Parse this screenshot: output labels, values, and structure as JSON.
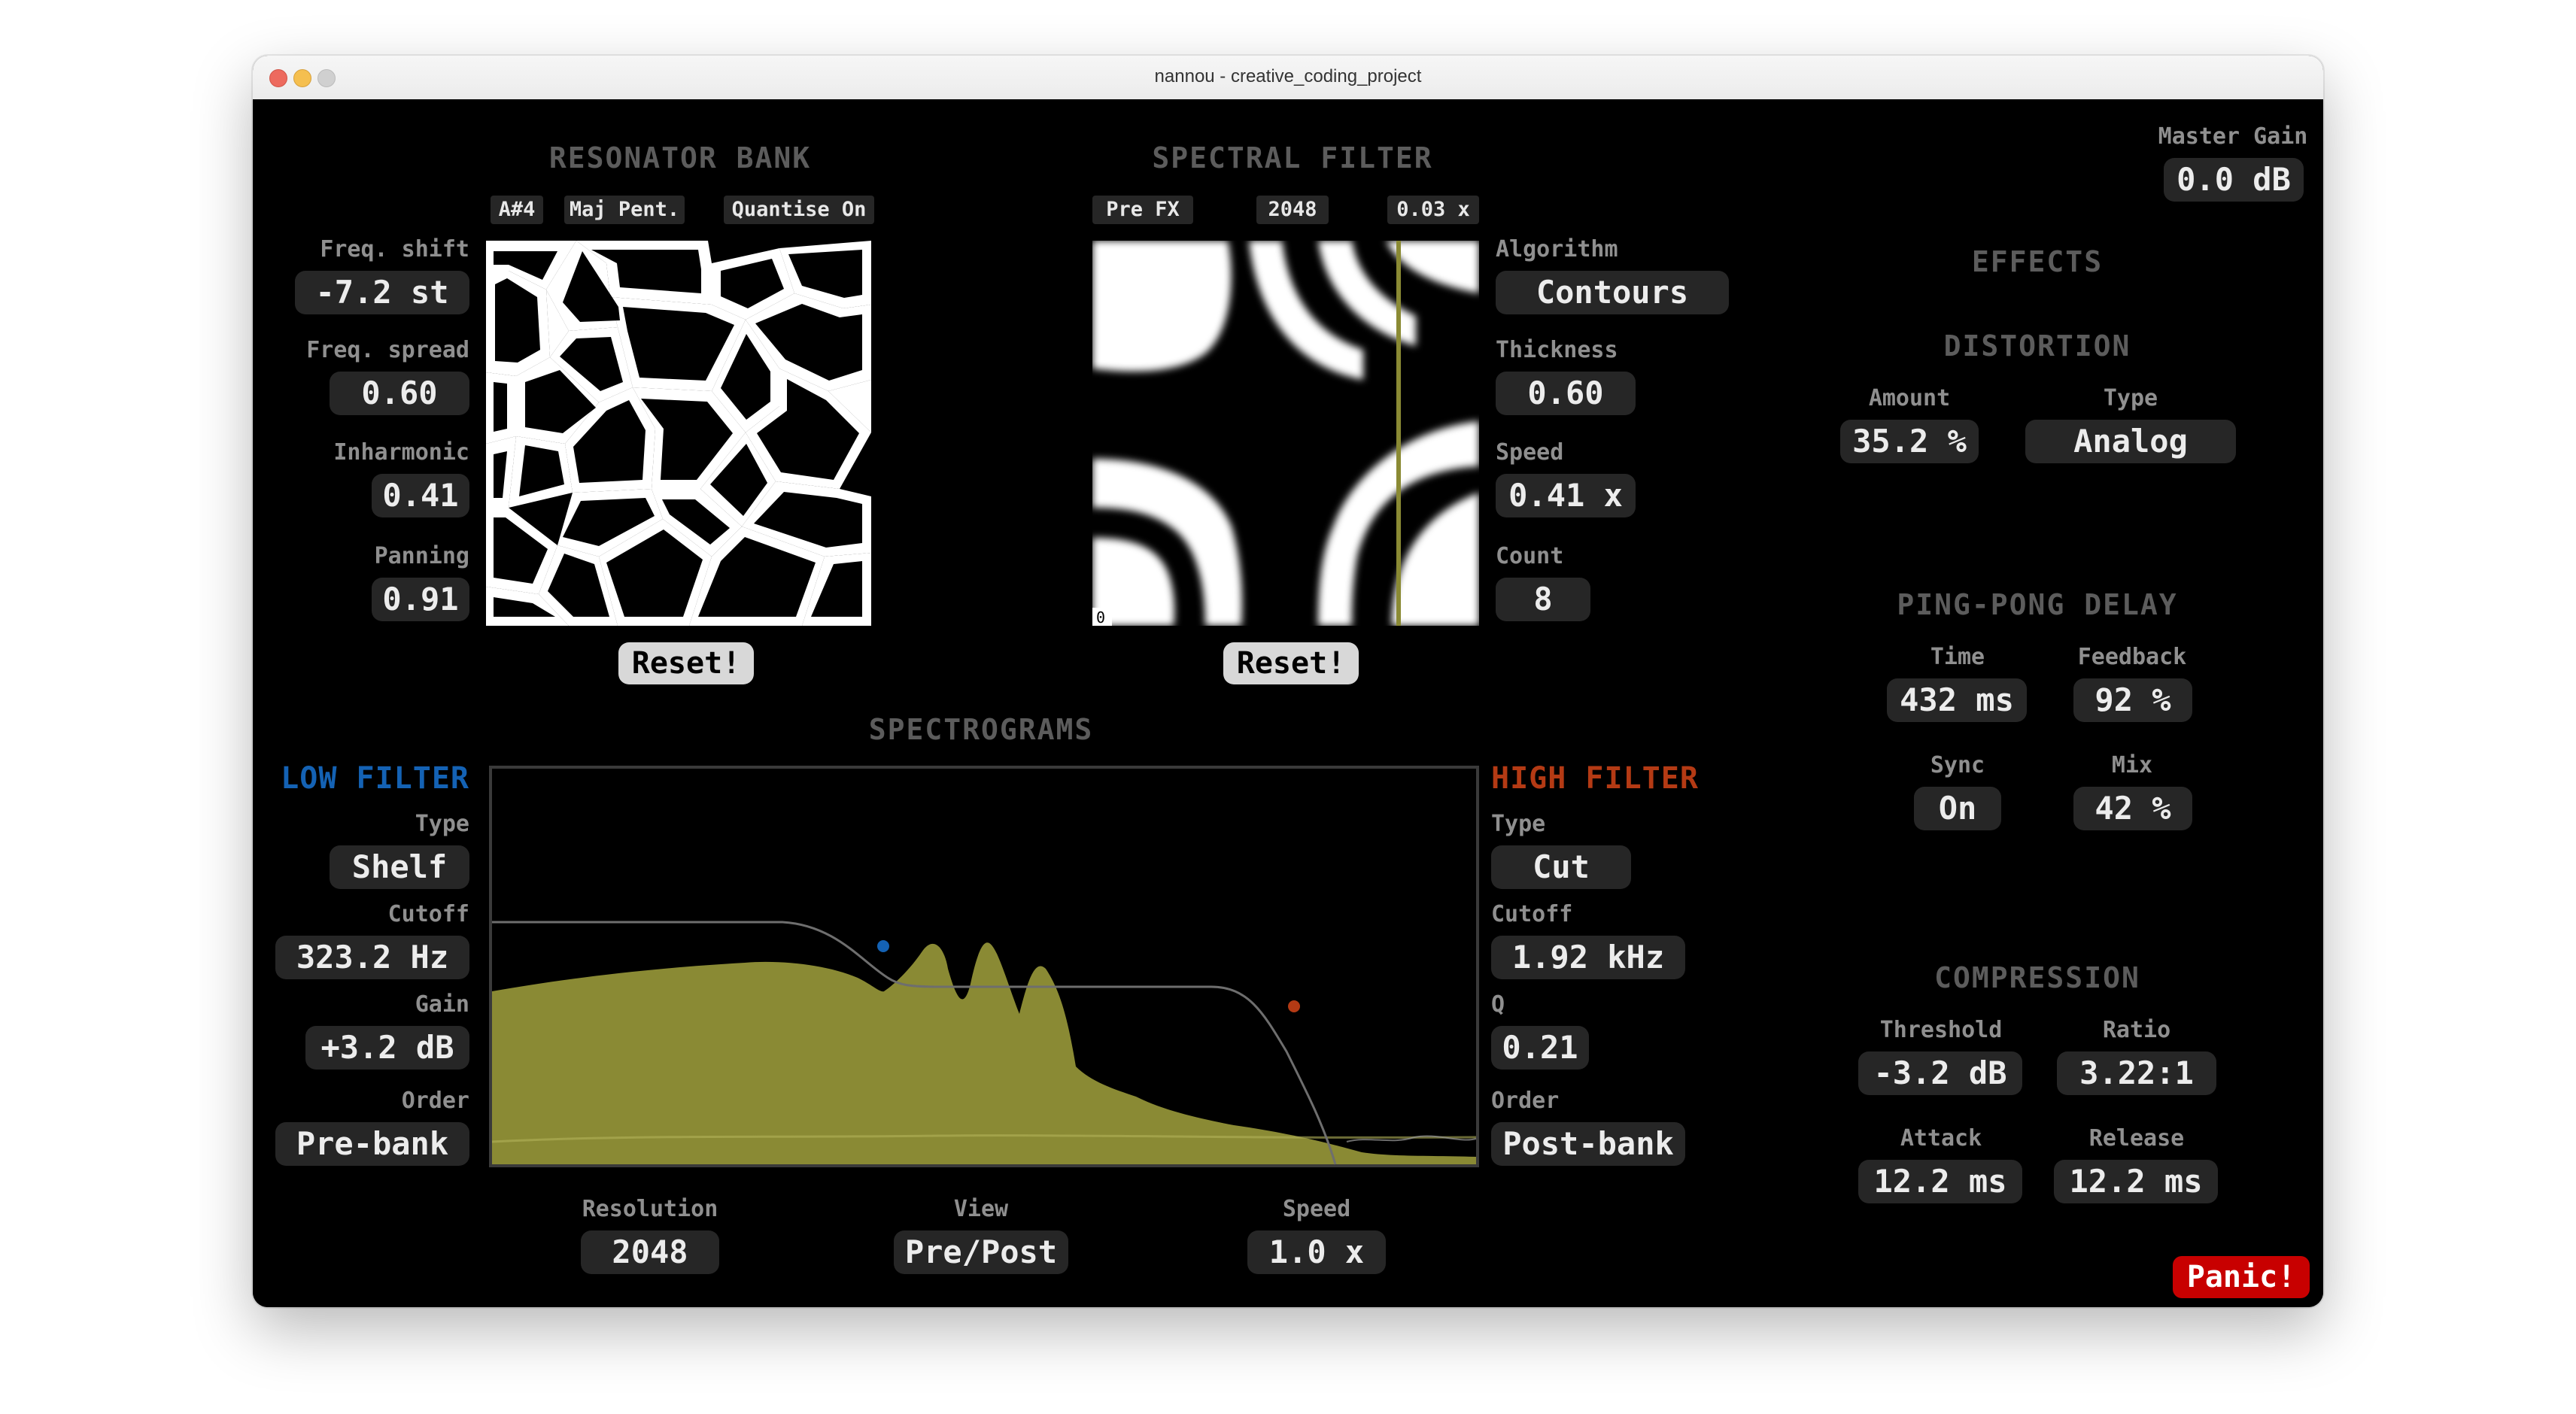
{
  "window": {
    "title": "nannou - creative_coding_project"
  },
  "resonator": {
    "title": "RESONATOR BANK",
    "tags": [
      "A#4",
      "Maj Pent.",
      "Quantise On"
    ],
    "freq_shift": {
      "label": "Freq. shift",
      "value": "-7.2 st"
    },
    "freq_spread": {
      "label": "Freq. spread",
      "value": "0.60"
    },
    "inharmonic": {
      "label": "Inharmonic",
      "value": "0.41"
    },
    "panning": {
      "label": "Panning",
      "value": "0.91"
    },
    "reset": "Reset!"
  },
  "spectral": {
    "title": "SPECTRAL FILTER",
    "tags": [
      "Pre FX",
      "2048",
      "0.03 x"
    ],
    "algorithm": {
      "label": "Algorithm",
      "value": "Contours"
    },
    "thickness": {
      "label": "Thickness",
      "value": "0.60"
    },
    "speed": {
      "label": "Speed",
      "value": "0.41 x"
    },
    "count": {
      "label": "Count",
      "value": "8"
    },
    "corner_marker": "0",
    "reset": "Reset!"
  },
  "spectrograms": {
    "title": "SPECTROGRAMS",
    "resolution": {
      "label": "Resolution",
      "value": "2048"
    },
    "view": {
      "label": "View",
      "value": "Pre/Post"
    },
    "speed": {
      "label": "Speed",
      "value": "1.0 x"
    }
  },
  "low_filter": {
    "title": "LOW FILTER",
    "type": {
      "label": "Type",
      "value": "Shelf"
    },
    "cutoff": {
      "label": "Cutoff",
      "value": "323.2 Hz"
    },
    "gain": {
      "label": "Gain",
      "value": "+3.2 dB"
    },
    "order": {
      "label": "Order",
      "value": "Pre-bank"
    }
  },
  "high_filter": {
    "title": "HIGH FILTER",
    "type": {
      "label": "Type",
      "value": "Cut"
    },
    "cutoff": {
      "label": "Cutoff",
      "value": "1.92 kHz"
    },
    "q": {
      "label": "Q",
      "value": "0.21"
    },
    "order": {
      "label": "Order",
      "value": "Post-bank"
    }
  },
  "master": {
    "label": "Master Gain",
    "value": "0.0 dB"
  },
  "effects": {
    "title": "EFFECTS",
    "distortion": {
      "title": "DISTORTION",
      "amount": {
        "label": "Amount",
        "value": "35.2 %"
      },
      "type": {
        "label": "Type",
        "value": "Analog"
      }
    },
    "delay": {
      "title": "PING-PONG DELAY",
      "time": {
        "label": "Time",
        "value": "432 ms"
      },
      "feedback": {
        "label": "Feedback",
        "value": "92 %"
      },
      "sync": {
        "label": "Sync",
        "value": "On"
      },
      "mix": {
        "label": "Mix",
        "value": "42 %"
      }
    },
    "compression": {
      "title": "COMPRESSION",
      "threshold": {
        "label": "Threshold",
        "value": "-3.2 dB"
      },
      "ratio": {
        "label": "Ratio",
        "value": "3.22:1"
      },
      "attack": {
        "label": "Attack",
        "value": "12.2 ms"
      },
      "release": {
        "label": "Release",
        "value": "12.2 ms"
      }
    }
  },
  "panic": "Panic!",
  "colors": {
    "background": "#000000",
    "control_bg": "#262626",
    "header": "#5c5c5c",
    "label": "#8f8f8f",
    "low_filter": "#1462b4",
    "high_filter": "#b43a14",
    "spectrum": "#8a8a34",
    "panic": "#c80000"
  }
}
